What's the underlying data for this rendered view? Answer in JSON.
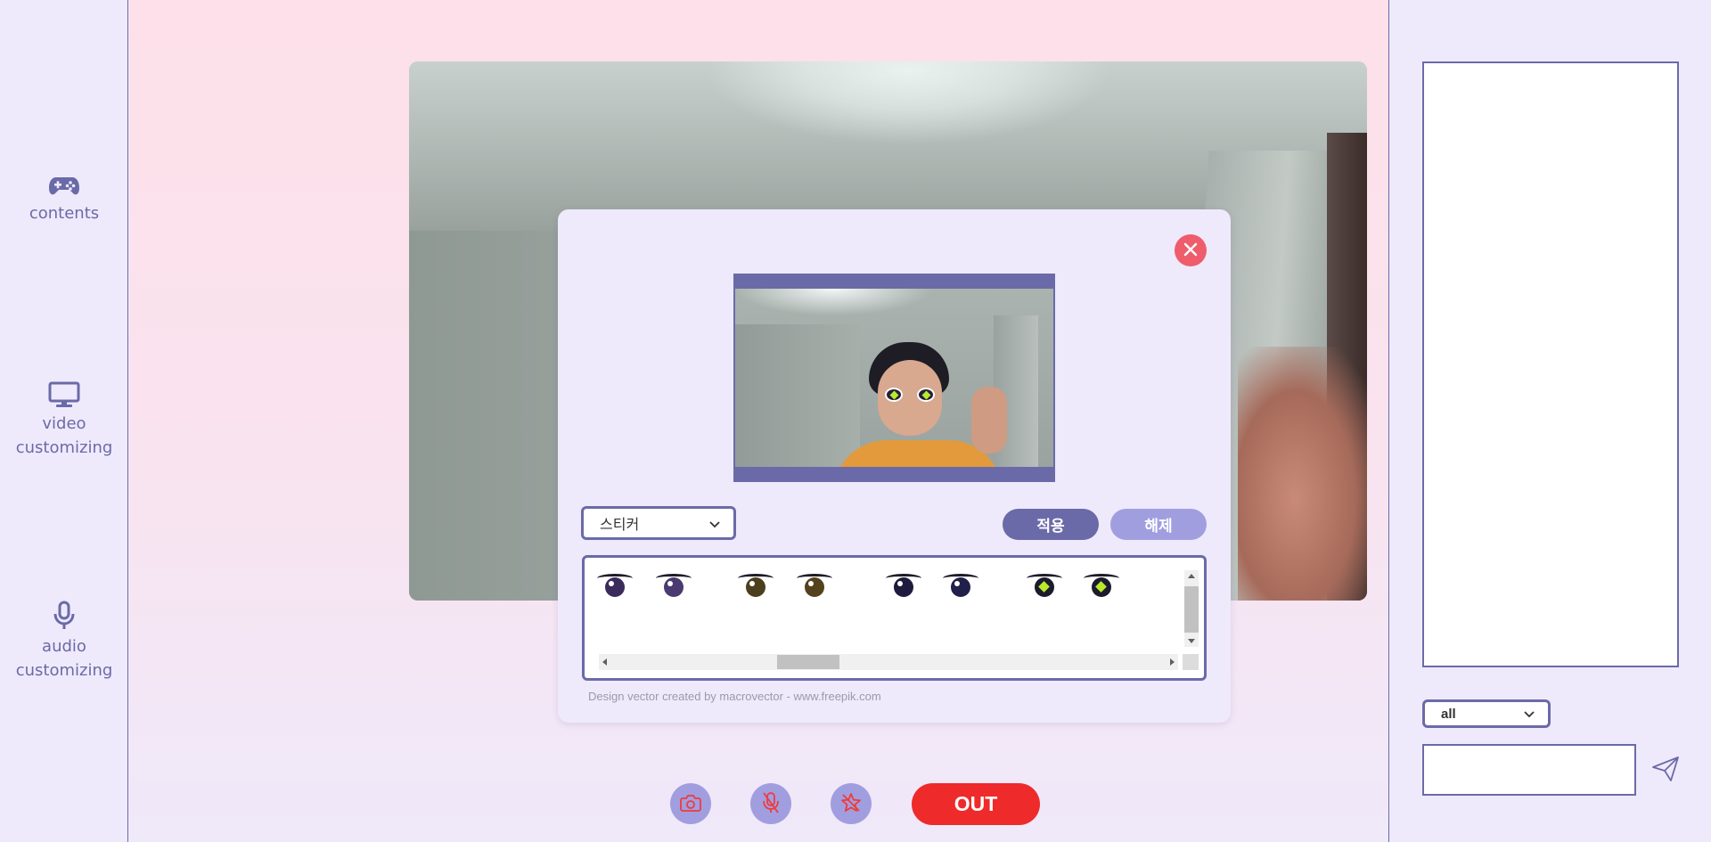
{
  "sidebar": {
    "items": [
      {
        "label": "contents",
        "icon": "gamepad-icon"
      },
      {
        "label_line1": "video",
        "label_line2": "customizing",
        "icon": "monitor-icon"
      },
      {
        "label_line1": "audio",
        "label_line2": "customizing",
        "icon": "microphone-icon"
      }
    ]
  },
  "modal": {
    "filter_select": {
      "selected": "스티커"
    },
    "apply_label": "적용",
    "remove_label": "해제",
    "credit": "Design vector created by macrovector - www.freepik.com",
    "stickers": [
      {
        "name": "eye-purple-1",
        "iris": "#3b2b5c"
      },
      {
        "name": "eye-purple-2",
        "iris": "#4a3a70"
      },
      {
        "name": "eye-brown-1",
        "iris": "#4d3e1e"
      },
      {
        "name": "eye-brown-2",
        "iris": "#54421c"
      },
      {
        "name": "eye-navy-1",
        "iris": "#1e1b3f"
      },
      {
        "name": "eye-navy-2",
        "iris": "#20204a"
      },
      {
        "name": "eye-star-1",
        "iris": "#1c1b2e"
      },
      {
        "name": "eye-star-2",
        "iris": "#1c1b2e"
      }
    ]
  },
  "controls": {
    "camera_icon": "camera-icon",
    "mic_icon": "microphone-icon",
    "effects_icon": "star-off-icon",
    "out_label": "OUT"
  },
  "chat": {
    "target_select": {
      "selected": "all"
    },
    "input_value": "",
    "send_icon": "paper-plane-icon"
  },
  "colors": {
    "accent": "#6b6aa8",
    "accent_light": "#a19ee0",
    "danger": "#ef2a2a",
    "close": "#ef5c6b",
    "bg": "#efeafb"
  }
}
